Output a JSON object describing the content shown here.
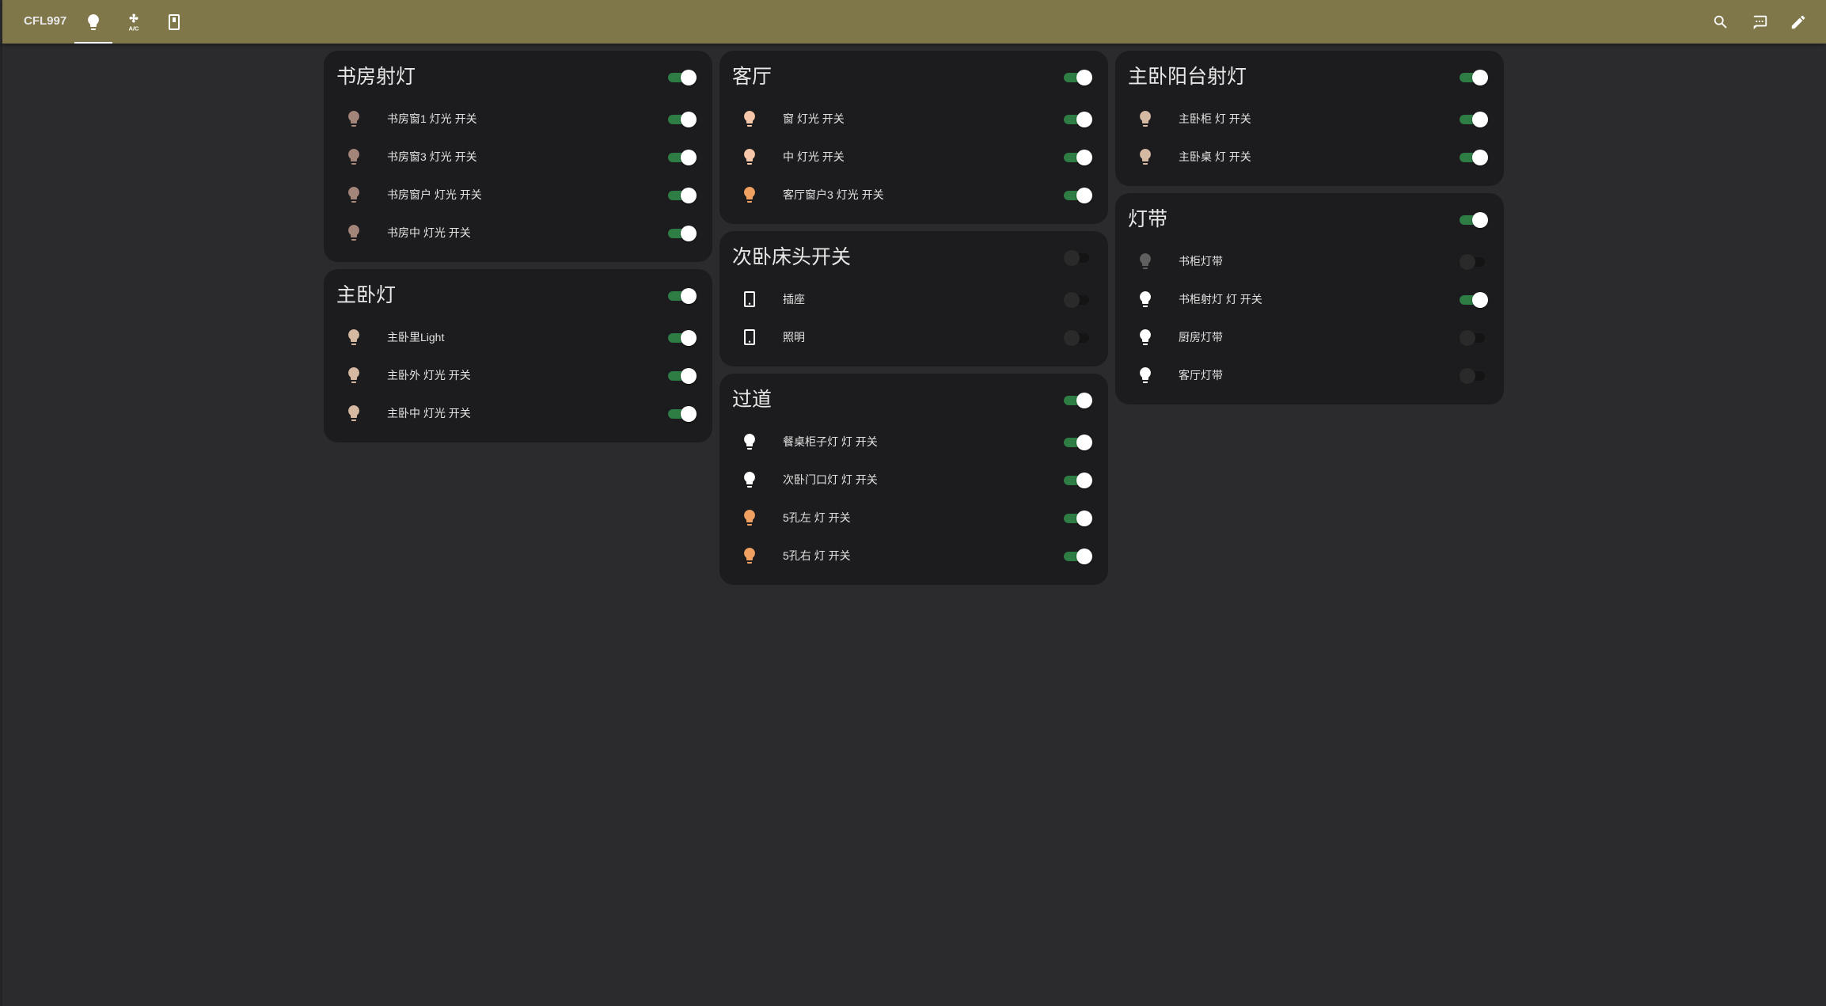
{
  "header": {
    "title": "CFL997",
    "tabs": [
      {
        "name": "lights",
        "icon": "lightbulb-icon",
        "active": true
      },
      {
        "name": "ac",
        "icon": "ac-fan-icon",
        "text": "A/C",
        "active": false
      },
      {
        "name": "switch",
        "icon": "switch-icon",
        "active": false
      }
    ],
    "actions": [
      {
        "name": "search",
        "icon": "search-icon"
      },
      {
        "name": "assist",
        "icon": "assist-icon"
      },
      {
        "name": "edit",
        "icon": "pencil-icon"
      }
    ]
  },
  "colors": {
    "header_bg": "#7f7649",
    "page_bg": "#2b2b2d",
    "card_bg": "#1c1c1e",
    "toggle_on": "#2e7d45",
    "bulb_warm_dim": "#a4857a",
    "bulb_warm": "#d6b9a2",
    "bulb_peach": "#f5c7a8",
    "bulb_orange": "#f0a060",
    "bulb_white": "#ffffff",
    "bulb_off": "#5f5f5f"
  },
  "cards": [
    {
      "title": "书房射灯",
      "on": true,
      "items": [
        {
          "label": "书房窗1 灯光 开关",
          "icon": "lightbulb-icon",
          "color": "#a4857a",
          "on": true
        },
        {
          "label": "书房窗3 灯光 开关",
          "icon": "lightbulb-icon",
          "color": "#a4857a",
          "on": true
        },
        {
          "label": "书房窗户 灯光 开关",
          "icon": "lightbulb-icon",
          "color": "#a4857a",
          "on": true
        },
        {
          "label": "书房中 灯光 开关",
          "icon": "lightbulb-icon",
          "color": "#a4857a",
          "on": true
        }
      ]
    },
    {
      "title": "主卧灯",
      "on": true,
      "items": [
        {
          "label": "主卧里Light",
          "icon": "lightbulb-icon",
          "color": "#d6b9a2",
          "on": true
        },
        {
          "label": "主卧外 灯光 开关",
          "icon": "lightbulb-icon",
          "color": "#d6b9a2",
          "on": true
        },
        {
          "label": "主卧中 灯光 开关",
          "icon": "lightbulb-icon",
          "color": "#d6b9a2",
          "on": true
        }
      ]
    },
    {
      "title": "客厅",
      "on": true,
      "items": [
        {
          "label": "窗 灯光 开关",
          "icon": "lightbulb-icon",
          "color": "#f5c7a8",
          "on": true
        },
        {
          "label": "中 灯光 开关",
          "icon": "lightbulb-icon",
          "color": "#f5c7a8",
          "on": true
        },
        {
          "label": "客厅窗户3 灯光 开关",
          "icon": "lightbulb-icon",
          "color": "#f0a060",
          "on": true
        }
      ]
    },
    {
      "title": "次卧床头开关",
      "on": false,
      "items": [
        {
          "label": "插座",
          "icon": "switch-icon",
          "color": "#ffffff",
          "on": false
        },
        {
          "label": "照明",
          "icon": "switch-icon",
          "color": "#ffffff",
          "on": false
        }
      ]
    },
    {
      "title": "过道",
      "on": true,
      "items": [
        {
          "label": "餐桌柜子灯 灯 开关",
          "icon": "lightbulb-icon",
          "color": "#ffffff",
          "on": true
        },
        {
          "label": "次卧门口灯 灯 开关",
          "icon": "lightbulb-icon",
          "color": "#ffffff",
          "on": true
        },
        {
          "label": "5孔左 灯 开关",
          "icon": "lightbulb-icon",
          "color": "#f0a060",
          "on": true
        },
        {
          "label": "5孔右 灯 开关",
          "icon": "lightbulb-icon",
          "color": "#f0a060",
          "on": true
        }
      ]
    },
    {
      "title": "主卧阳台射灯",
      "on": true,
      "items": [
        {
          "label": "主卧柜 灯 开关",
          "icon": "lightbulb-icon",
          "color": "#d6b9a2",
          "on": true
        },
        {
          "label": "主卧桌 灯 开关",
          "icon": "lightbulb-icon",
          "color": "#d6b9a2",
          "on": true
        }
      ]
    },
    {
      "title": "灯带",
      "on": true,
      "items": [
        {
          "label": "书柜灯带",
          "icon": "lightbulb-icon",
          "color": "#5f5f5f",
          "on": false
        },
        {
          "label": "书柜射灯 灯 开关",
          "icon": "lightbulb-icon",
          "color": "#ffffff",
          "on": true
        },
        {
          "label": "厨房灯带",
          "icon": "lightbulb-icon",
          "color": "#ffffff",
          "on": false
        },
        {
          "label": "客厅灯带",
          "icon": "lightbulb-icon",
          "color": "#ffffff",
          "on": false
        }
      ]
    }
  ]
}
